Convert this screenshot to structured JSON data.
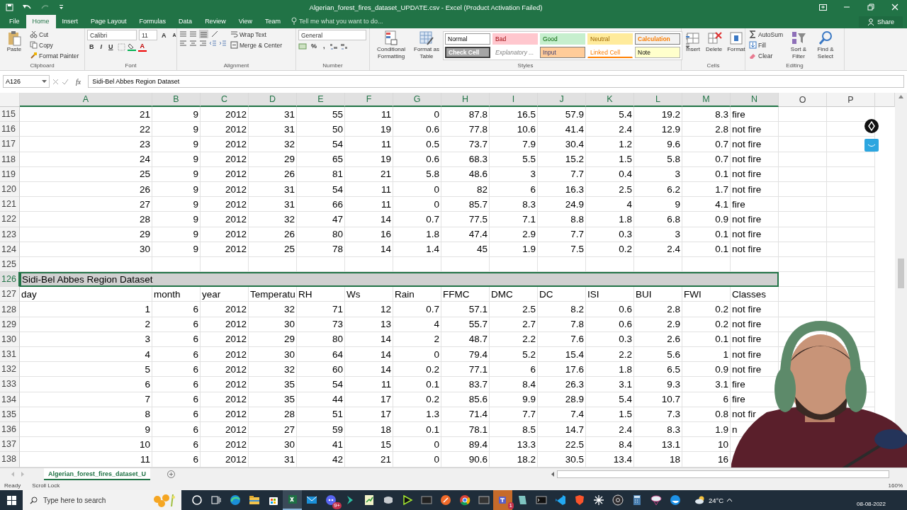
{
  "window": {
    "title": "Algerian_forest_fires_dataset_UPDATE.csv - Excel (Product Activation Failed)",
    "share": "Share"
  },
  "ribbon_tabs": [
    {
      "label": "File",
      "selected": false
    },
    {
      "label": "Home",
      "selected": true
    },
    {
      "label": "Insert",
      "selected": false
    },
    {
      "label": "Page Layout",
      "selected": false
    },
    {
      "label": "Formulas",
      "selected": false
    },
    {
      "label": "Data",
      "selected": false
    },
    {
      "label": "Review",
      "selected": false
    },
    {
      "label": "View",
      "selected": false
    },
    {
      "label": "Team",
      "selected": false
    }
  ],
  "tell_me": "Tell me what you want to do...",
  "ribbon": {
    "clipboard": {
      "label": "Clipboard",
      "paste": "Paste",
      "cut": "Cut",
      "copy": "Copy",
      "format_painter": "Format Painter"
    },
    "font": {
      "label": "Font",
      "name": "Calibri",
      "size": "11",
      "grow": "A",
      "shrink": "A",
      "bold": "B",
      "italic": "I",
      "underline": "U",
      "font_color": "A"
    },
    "alignment": {
      "label": "Alignment",
      "wrap_text": "Wrap Text",
      "merge_center": "Merge & Center"
    },
    "number": {
      "label": "Number",
      "format": "General",
      "percent": "%",
      "comma": ","
    },
    "styles": {
      "label": "Styles",
      "conditional": "Conditional Formatting",
      "format_table": "Format as Table",
      "cells": [
        {
          "label": "Normal",
          "color": "#ffffff"
        },
        {
          "label": "Bad",
          "color": "#ffc7ce"
        },
        {
          "label": "Good",
          "color": "#c6efce"
        },
        {
          "label": "Neutral",
          "color": "#ffeb9c"
        },
        {
          "label": "Calculation",
          "color": "#f2f2f2"
        },
        {
          "label": "Check Cell",
          "color": "#a5a5a5"
        },
        {
          "label": "Explanatory ...",
          "color": "#ffffff"
        },
        {
          "label": "Input",
          "color": "#ffcc99"
        },
        {
          "label": "Linked Cell",
          "color": "#ffffff"
        },
        {
          "label": "Note",
          "color": "#ffffcc"
        }
      ]
    },
    "cells": {
      "label": "Cells",
      "insert": "Insert",
      "delete": "Delete",
      "format": "Format"
    },
    "editing": {
      "label": "Editing",
      "autosum": "AutoSum",
      "fill": "Fill",
      "clear": "Clear",
      "sort_filter": "Sort & Filter",
      "find_select": "Find & Select"
    }
  },
  "formula_bar": {
    "name_box": "A126",
    "function_label": "fx",
    "value": "Sidi-Bel Abbes Region Dataset"
  },
  "columns": [
    {
      "label": "A",
      "selected": true
    },
    {
      "label": "B",
      "selected": true
    },
    {
      "label": "C",
      "selected": true
    },
    {
      "label": "D",
      "selected": true
    },
    {
      "label": "E",
      "selected": true
    },
    {
      "label": "F",
      "selected": true
    },
    {
      "label": "G",
      "selected": true
    },
    {
      "label": "H",
      "selected": true
    },
    {
      "label": "I",
      "selected": true
    },
    {
      "label": "J",
      "selected": true
    },
    {
      "label": "K",
      "selected": true
    },
    {
      "label": "L",
      "selected": true
    },
    {
      "label": "M",
      "selected": true
    },
    {
      "label": "N",
      "selected": true
    },
    {
      "label": "O",
      "selected": false
    },
    {
      "label": "P",
      "selected": false
    }
  ],
  "rows": [
    {
      "number": "115",
      "kind": "data",
      "selected": false,
      "cells": [
        "21",
        "9",
        "2012",
        "31",
        "55",
        "11",
        "0",
        "87.8",
        "16.5",
        "57.9",
        "5.4",
        "19.2",
        "8.3",
        "fire"
      ]
    },
    {
      "number": "116",
      "kind": "data",
      "selected": false,
      "cells": [
        "22",
        "9",
        "2012",
        "31",
        "50",
        "19",
        "0.6",
        "77.8",
        "10.6",
        "41.4",
        "2.4",
        "12.9",
        "2.8",
        "not fire"
      ]
    },
    {
      "number": "117",
      "kind": "data",
      "selected": false,
      "cells": [
        "23",
        "9",
        "2012",
        "32",
        "54",
        "11",
        "0.5",
        "73.7",
        "7.9",
        "30.4",
        "1.2",
        "9.6",
        "0.7",
        "not fire"
      ]
    },
    {
      "number": "118",
      "kind": "data",
      "selected": false,
      "cells": [
        "24",
        "9",
        "2012",
        "29",
        "65",
        "19",
        "0.6",
        "68.3",
        "5.5",
        "15.2",
        "1.5",
        "5.8",
        "0.7",
        "not fire"
      ]
    },
    {
      "number": "119",
      "kind": "data",
      "selected": false,
      "cells": [
        "25",
        "9",
        "2012",
        "26",
        "81",
        "21",
        "5.8",
        "48.6",
        "3",
        "7.7",
        "0.4",
        "3",
        "0.1",
        "not fire"
      ]
    },
    {
      "number": "120",
      "kind": "data",
      "selected": false,
      "cells": [
        "26",
        "9",
        "2012",
        "31",
        "54",
        "11",
        "0",
        "82",
        "6",
        "16.3",
        "2.5",
        "6.2",
        "1.7",
        "not fire"
      ]
    },
    {
      "number": "121",
      "kind": "data",
      "selected": false,
      "cells": [
        "27",
        "9",
        "2012",
        "31",
        "66",
        "11",
        "0",
        "85.7",
        "8.3",
        "24.9",
        "4",
        "9",
        "4.1",
        "fire"
      ]
    },
    {
      "number": "122",
      "kind": "data",
      "selected": false,
      "cells": [
        "28",
        "9",
        "2012",
        "32",
        "47",
        "14",
        "0.7",
        "77.5",
        "7.1",
        "8.8",
        "1.8",
        "6.8",
        "0.9",
        "not fire"
      ]
    },
    {
      "number": "123",
      "kind": "data",
      "selected": false,
      "cells": [
        "29",
        "9",
        "2012",
        "26",
        "80",
        "16",
        "1.8",
        "47.4",
        "2.9",
        "7.7",
        "0.3",
        "3",
        "0.1",
        "not fire"
      ]
    },
    {
      "number": "124",
      "kind": "data",
      "selected": false,
      "cells": [
        "30",
        "9",
        "2012",
        "25",
        "78",
        "14",
        "1.4",
        "45",
        "1.9",
        "7.5",
        "0.2",
        "2.4",
        "0.1",
        "not fire"
      ]
    },
    {
      "number": "125",
      "kind": "empty",
      "selected": false,
      "cells": []
    },
    {
      "number": "126",
      "kind": "banner",
      "selected": true,
      "cells": [
        "Sidi-Bel Abbes Region Dataset"
      ]
    },
    {
      "number": "127",
      "kind": "header",
      "selected": false,
      "cells": [
        "day",
        "month",
        "year",
        "Temperatu",
        "RH",
        "Ws",
        "Rain",
        "FFMC",
        "DMC",
        "DC",
        "ISI",
        "BUI",
        "FWI",
        "Classes"
      ]
    },
    {
      "number": "128",
      "kind": "data",
      "selected": false,
      "cells": [
        "1",
        "6",
        "2012",
        "32",
        "71",
        "12",
        "0.7",
        "57.1",
        "2.5",
        "8.2",
        "0.6",
        "2.8",
        "0.2",
        "not fire"
      ]
    },
    {
      "number": "129",
      "kind": "data",
      "selected": false,
      "cells": [
        "2",
        "6",
        "2012",
        "30",
        "73",
        "13",
        "4",
        "55.7",
        "2.7",
        "7.8",
        "0.6",
        "2.9",
        "0.2",
        "not fire"
      ]
    },
    {
      "number": "130",
      "kind": "data",
      "selected": false,
      "cells": [
        "3",
        "6",
        "2012",
        "29",
        "80",
        "14",
        "2",
        "48.7",
        "2.2",
        "7.6",
        "0.3",
        "2.6",
        "0.1",
        "not fire"
      ]
    },
    {
      "number": "131",
      "kind": "data",
      "selected": false,
      "cells": [
        "4",
        "6",
        "2012",
        "30",
        "64",
        "14",
        "0",
        "79.4",
        "5.2",
        "15.4",
        "2.2",
        "5.6",
        "1",
        "not fire"
      ]
    },
    {
      "number": "132",
      "kind": "data",
      "selected": false,
      "cells": [
        "5",
        "6",
        "2012",
        "32",
        "60",
        "14",
        "0.2",
        "77.1",
        "6",
        "17.6",
        "1.8",
        "6.5",
        "0.9",
        "not fire"
      ]
    },
    {
      "number": "133",
      "kind": "data",
      "selected": false,
      "cells": [
        "6",
        "6",
        "2012",
        "35",
        "54",
        "11",
        "0.1",
        "83.7",
        "8.4",
        "26.3",
        "3.1",
        "9.3",
        "3.1",
        "fire"
      ]
    },
    {
      "number": "134",
      "kind": "data",
      "selected": false,
      "cells": [
        "7",
        "6",
        "2012",
        "35",
        "44",
        "17",
        "0.2",
        "85.6",
        "9.9",
        "28.9",
        "5.4",
        "10.7",
        "6",
        "fire"
      ]
    },
    {
      "number": "135",
      "kind": "data",
      "selected": false,
      "cells": [
        "8",
        "6",
        "2012",
        "28",
        "51",
        "17",
        "1.3",
        "71.4",
        "7.7",
        "7.4",
        "1.5",
        "7.3",
        "0.8",
        "not fir"
      ]
    },
    {
      "number": "136",
      "kind": "data",
      "selected": false,
      "cells": [
        "9",
        "6",
        "2012",
        "27",
        "59",
        "18",
        "0.1",
        "78.1",
        "8.5",
        "14.7",
        "2.4",
        "8.3",
        "1.9",
        "n"
      ]
    },
    {
      "number": "137",
      "kind": "data",
      "selected": false,
      "cells": [
        "10",
        "6",
        "2012",
        "30",
        "41",
        "15",
        "0",
        "89.4",
        "13.3",
        "22.5",
        "8.4",
        "13.1",
        "10"
      ]
    },
    {
      "number": "138",
      "kind": "data",
      "selected": false,
      "cells": [
        "11",
        "6",
        "2012",
        "31",
        "42",
        "21",
        "0",
        "90.6",
        "18.2",
        "30.5",
        "13.4",
        "18",
        "16"
      ]
    }
  ],
  "sheet_tabs": [
    {
      "label": "Algerian_forest_fires_dataset_U",
      "selected": true
    }
  ],
  "status_bar": {
    "items": [
      "Ready",
      "Scroll Lock"
    ],
    "zoom": "160%"
  },
  "taskbar": {
    "search_placeholder": "Type here to search",
    "apps": [
      {
        "selected": false
      },
      {
        "selected": false
      },
      {
        "selected": false
      },
      {
        "selected": false
      },
      {
        "selected": false
      },
      {
        "selected": true
      },
      {
        "selected": false
      },
      {
        "selected": false,
        "badge": "9+"
      },
      {
        "selected": false
      },
      {
        "selected": false
      },
      {
        "selected": false
      },
      {
        "selected": false
      },
      {
        "selected": false
      },
      {
        "selected": false
      },
      {
        "selected": false
      },
      {
        "selected": false
      },
      {
        "selected": false,
        "attention": true,
        "badge": "1"
      },
      {
        "selected": false
      },
      {
        "selected": false
      },
      {
        "selected": false
      },
      {
        "selected": false
      },
      {
        "selected": false
      },
      {
        "selected": false
      },
      {
        "selected": false
      },
      {
        "selected": false
      },
      {
        "selected": false
      }
    ],
    "weather": "24°C",
    "date": "08-08-2022"
  }
}
